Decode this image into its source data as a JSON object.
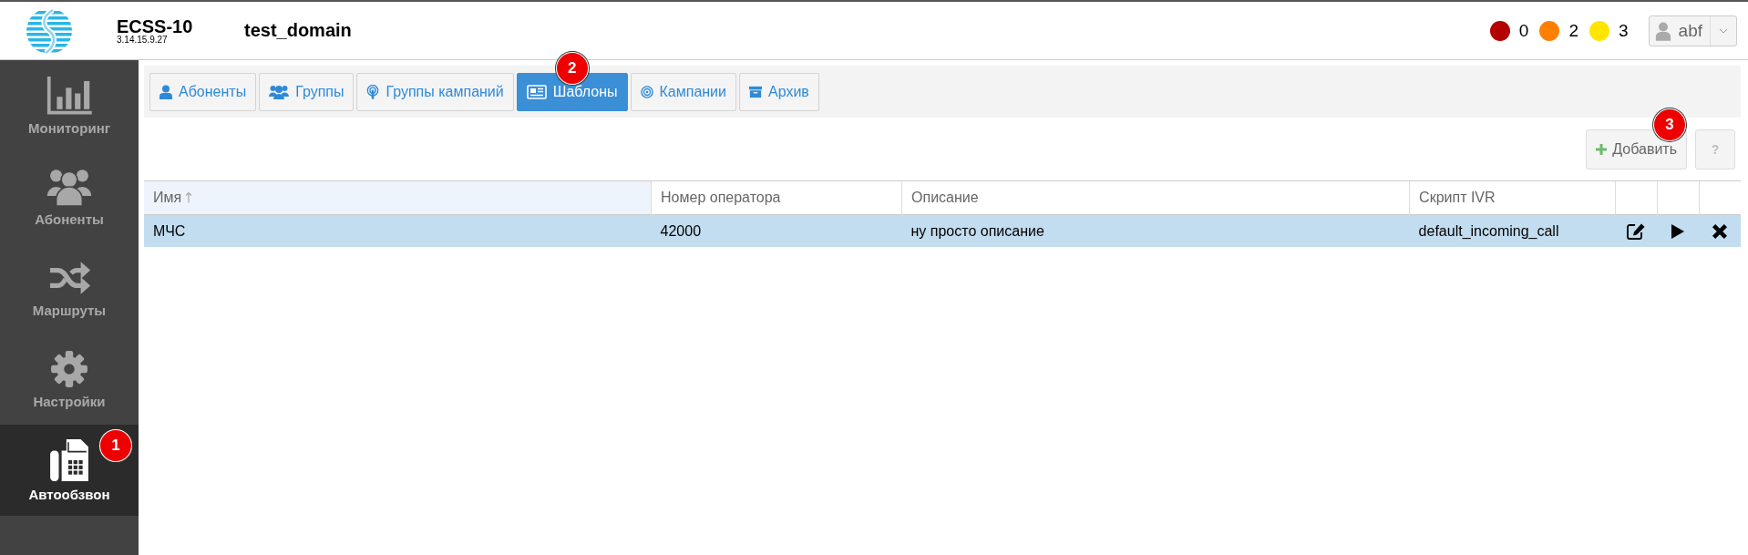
{
  "header": {
    "product": "ECSS-10",
    "version": "3.14.15.9.27",
    "domain": "test_domain",
    "alarms": [
      {
        "color": "#b30000",
        "count": "0"
      },
      {
        "color": "#ff7f00",
        "count": "2"
      },
      {
        "color": "#ffe600",
        "count": "3"
      }
    ],
    "user": "abf"
  },
  "sidebar": {
    "items": [
      {
        "kind": "chart",
        "label": "Мониторинг",
        "selected": false
      },
      {
        "kind": "users",
        "label": "Абоненты",
        "selected": false
      },
      {
        "kind": "shuffle",
        "label": "Маршруты",
        "selected": false
      },
      {
        "kind": "gear",
        "label": "Настройки",
        "selected": false
      },
      {
        "kind": "fax",
        "label": "Автообзвон",
        "selected": true,
        "badge": "1"
      }
    ]
  },
  "tabs": [
    {
      "kind": "user",
      "label": "Абоненты",
      "selected": false
    },
    {
      "kind": "users",
      "label": "Группы",
      "selected": false
    },
    {
      "kind": "podcast",
      "label": "Группы кампаний",
      "selected": false
    },
    {
      "kind": "newspaper",
      "label": "Шаблоны",
      "selected": true,
      "badge": "2"
    },
    {
      "kind": "target",
      "label": "Кампании",
      "selected": false
    },
    {
      "kind": "archive",
      "label": "Архив",
      "selected": false
    }
  ],
  "toolbar": {
    "add": {
      "label": "Добавить",
      "badge": "3"
    },
    "help": "?"
  },
  "table": {
    "columns": [
      {
        "label": "Имя",
        "sorted": true
      },
      {
        "label": "Номер оператора",
        "sorted": false
      },
      {
        "label": "Описание",
        "sorted": false
      },
      {
        "label": "Скрипт IVR",
        "sorted": false
      }
    ],
    "rows": [
      {
        "cells": [
          "МЧС",
          "42000",
          "ну просто описание",
          "default_incoming_call"
        ],
        "selected": true,
        "actions": [
          {
            "kind": "edit"
          },
          {
            "kind": "play"
          },
          {
            "kind": "delete"
          }
        ]
      }
    ]
  }
}
